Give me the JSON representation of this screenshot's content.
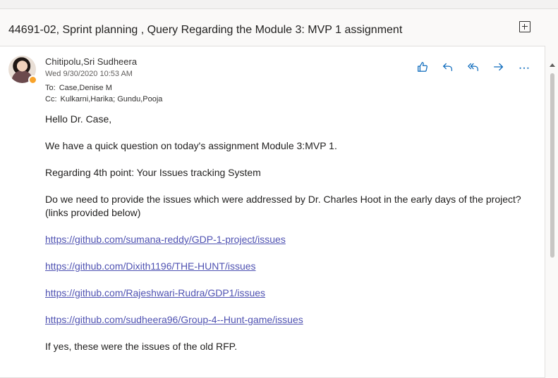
{
  "subject": "44691-02, Sprint planning , Query Regarding the Module 3: MVP 1 assignment",
  "message": {
    "sender": "Chitipolu,Sri Sudheera",
    "date": "Wed 9/30/2020 10:53 AM",
    "to_label": "To:",
    "to": "Case,Denise M",
    "cc_label": "Cc:",
    "cc": "Kulkarni,Harika; Gundu,Pooja",
    "presence": "away",
    "body": {
      "greeting": "Hello Dr. Case,",
      "line1": "We have a quick question on today's assignment Module 3:MVP 1.",
      "line2": "Regarding 4th point: Your Issues tracking System",
      "line3": "Do we need to provide the issues which were addressed by Dr. Charles Hoot in the early days of the project? (links provided below)",
      "links": [
        "https://github.com/sumana-reddy/GDP-1-project/issues",
        "https://github.com/Dixith1196/THE-HUNT/issues",
        "https://github.com/Rajeshwari-Rudra/GDP1/issues",
        "https://github.com/sudheera96/Group-4--Hunt-game/issues"
      ],
      "line4": "If yes, these were the issues of the old RFP."
    }
  },
  "actions": [
    "like-icon",
    "reply-icon",
    "reply-all-icon",
    "forward-icon",
    "more-icon"
  ],
  "colors": {
    "accent": "#0f6cbd",
    "link": "#4f52b2",
    "presence": "#f8a32b"
  }
}
